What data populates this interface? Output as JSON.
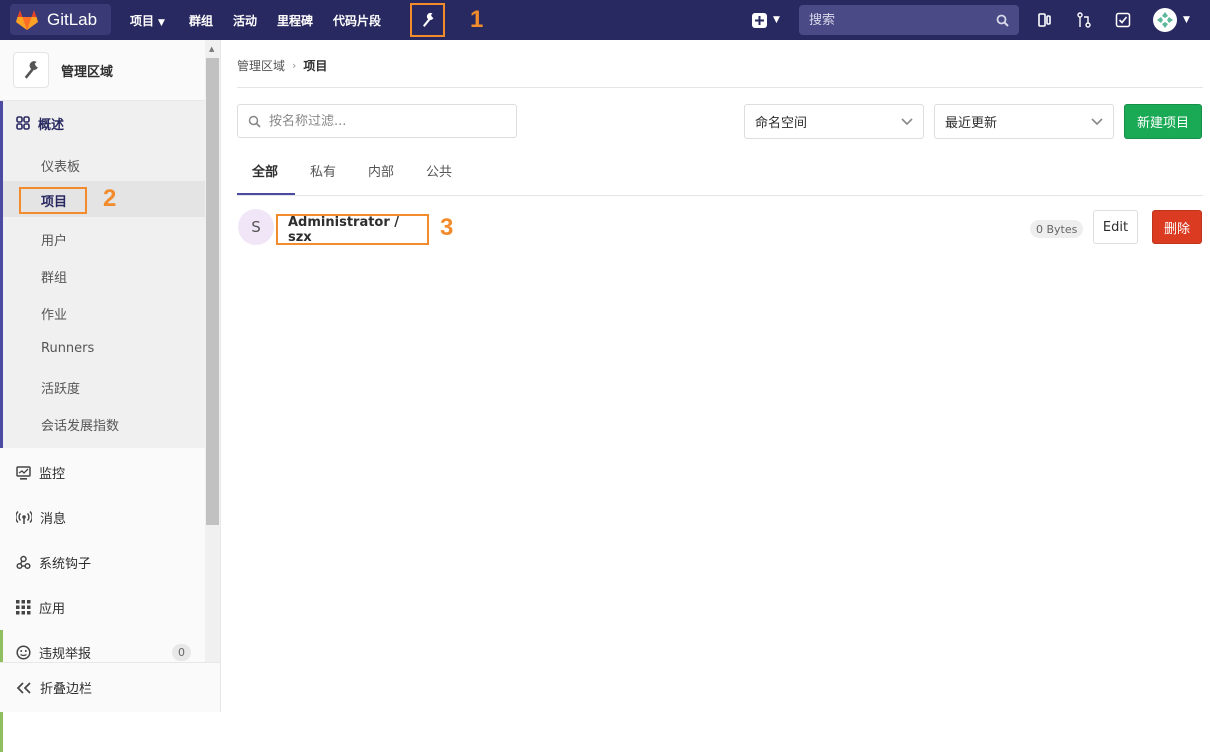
{
  "brand": {
    "name": "GitLab"
  },
  "topnav": {
    "projects": "项目",
    "groups": "群组",
    "activity": "活动",
    "milestones": "里程碑",
    "snippets": "代码片段",
    "search_placeholder": "搜索"
  },
  "annotations": {
    "one": "1",
    "two": "2",
    "three": "3"
  },
  "sidebar": {
    "title": "管理区域",
    "overview": "概述",
    "overview_items": [
      "仪表板",
      "项目",
      "用户",
      "群组",
      "作业",
      "Runners",
      "活跃度",
      "会话发展指数"
    ],
    "monitoring": "监控",
    "messages": "消息",
    "system_hooks": "系统钩子",
    "applications": "应用",
    "abuse_reports": "违规举报",
    "abuse_count": "0",
    "collapse": "折叠边栏"
  },
  "breadcrumb": {
    "parent": "管理区域",
    "current": "项目"
  },
  "filters": {
    "search_placeholder": "按名称过滤...",
    "namespace": "命名空间",
    "sort": "最近更新",
    "new_project": "新建项目"
  },
  "tabs": [
    "全部",
    "私有",
    "内部",
    "公共"
  ],
  "projects": [
    {
      "avatar": "S",
      "name": "Administrator / szx",
      "size": "0 Bytes",
      "edit": "Edit",
      "delete": "删除"
    }
  ],
  "colors": {
    "navbar": "#292961",
    "accent": "#4b4ba3",
    "annotation": "#f28b2c",
    "success": "#1aaa55",
    "danger": "#db3b21"
  },
  "icons": {
    "logo": "gitlab-tanuki-icon",
    "admin": "wrench-icon",
    "overview": "grid-icon",
    "monitoring": "monitor-icon",
    "messages": "broadcast-icon",
    "hooks": "hook-icon",
    "applications": "apps-icon",
    "abuse": "smiley-icon",
    "collapse": "double-chevron-left-icon"
  }
}
